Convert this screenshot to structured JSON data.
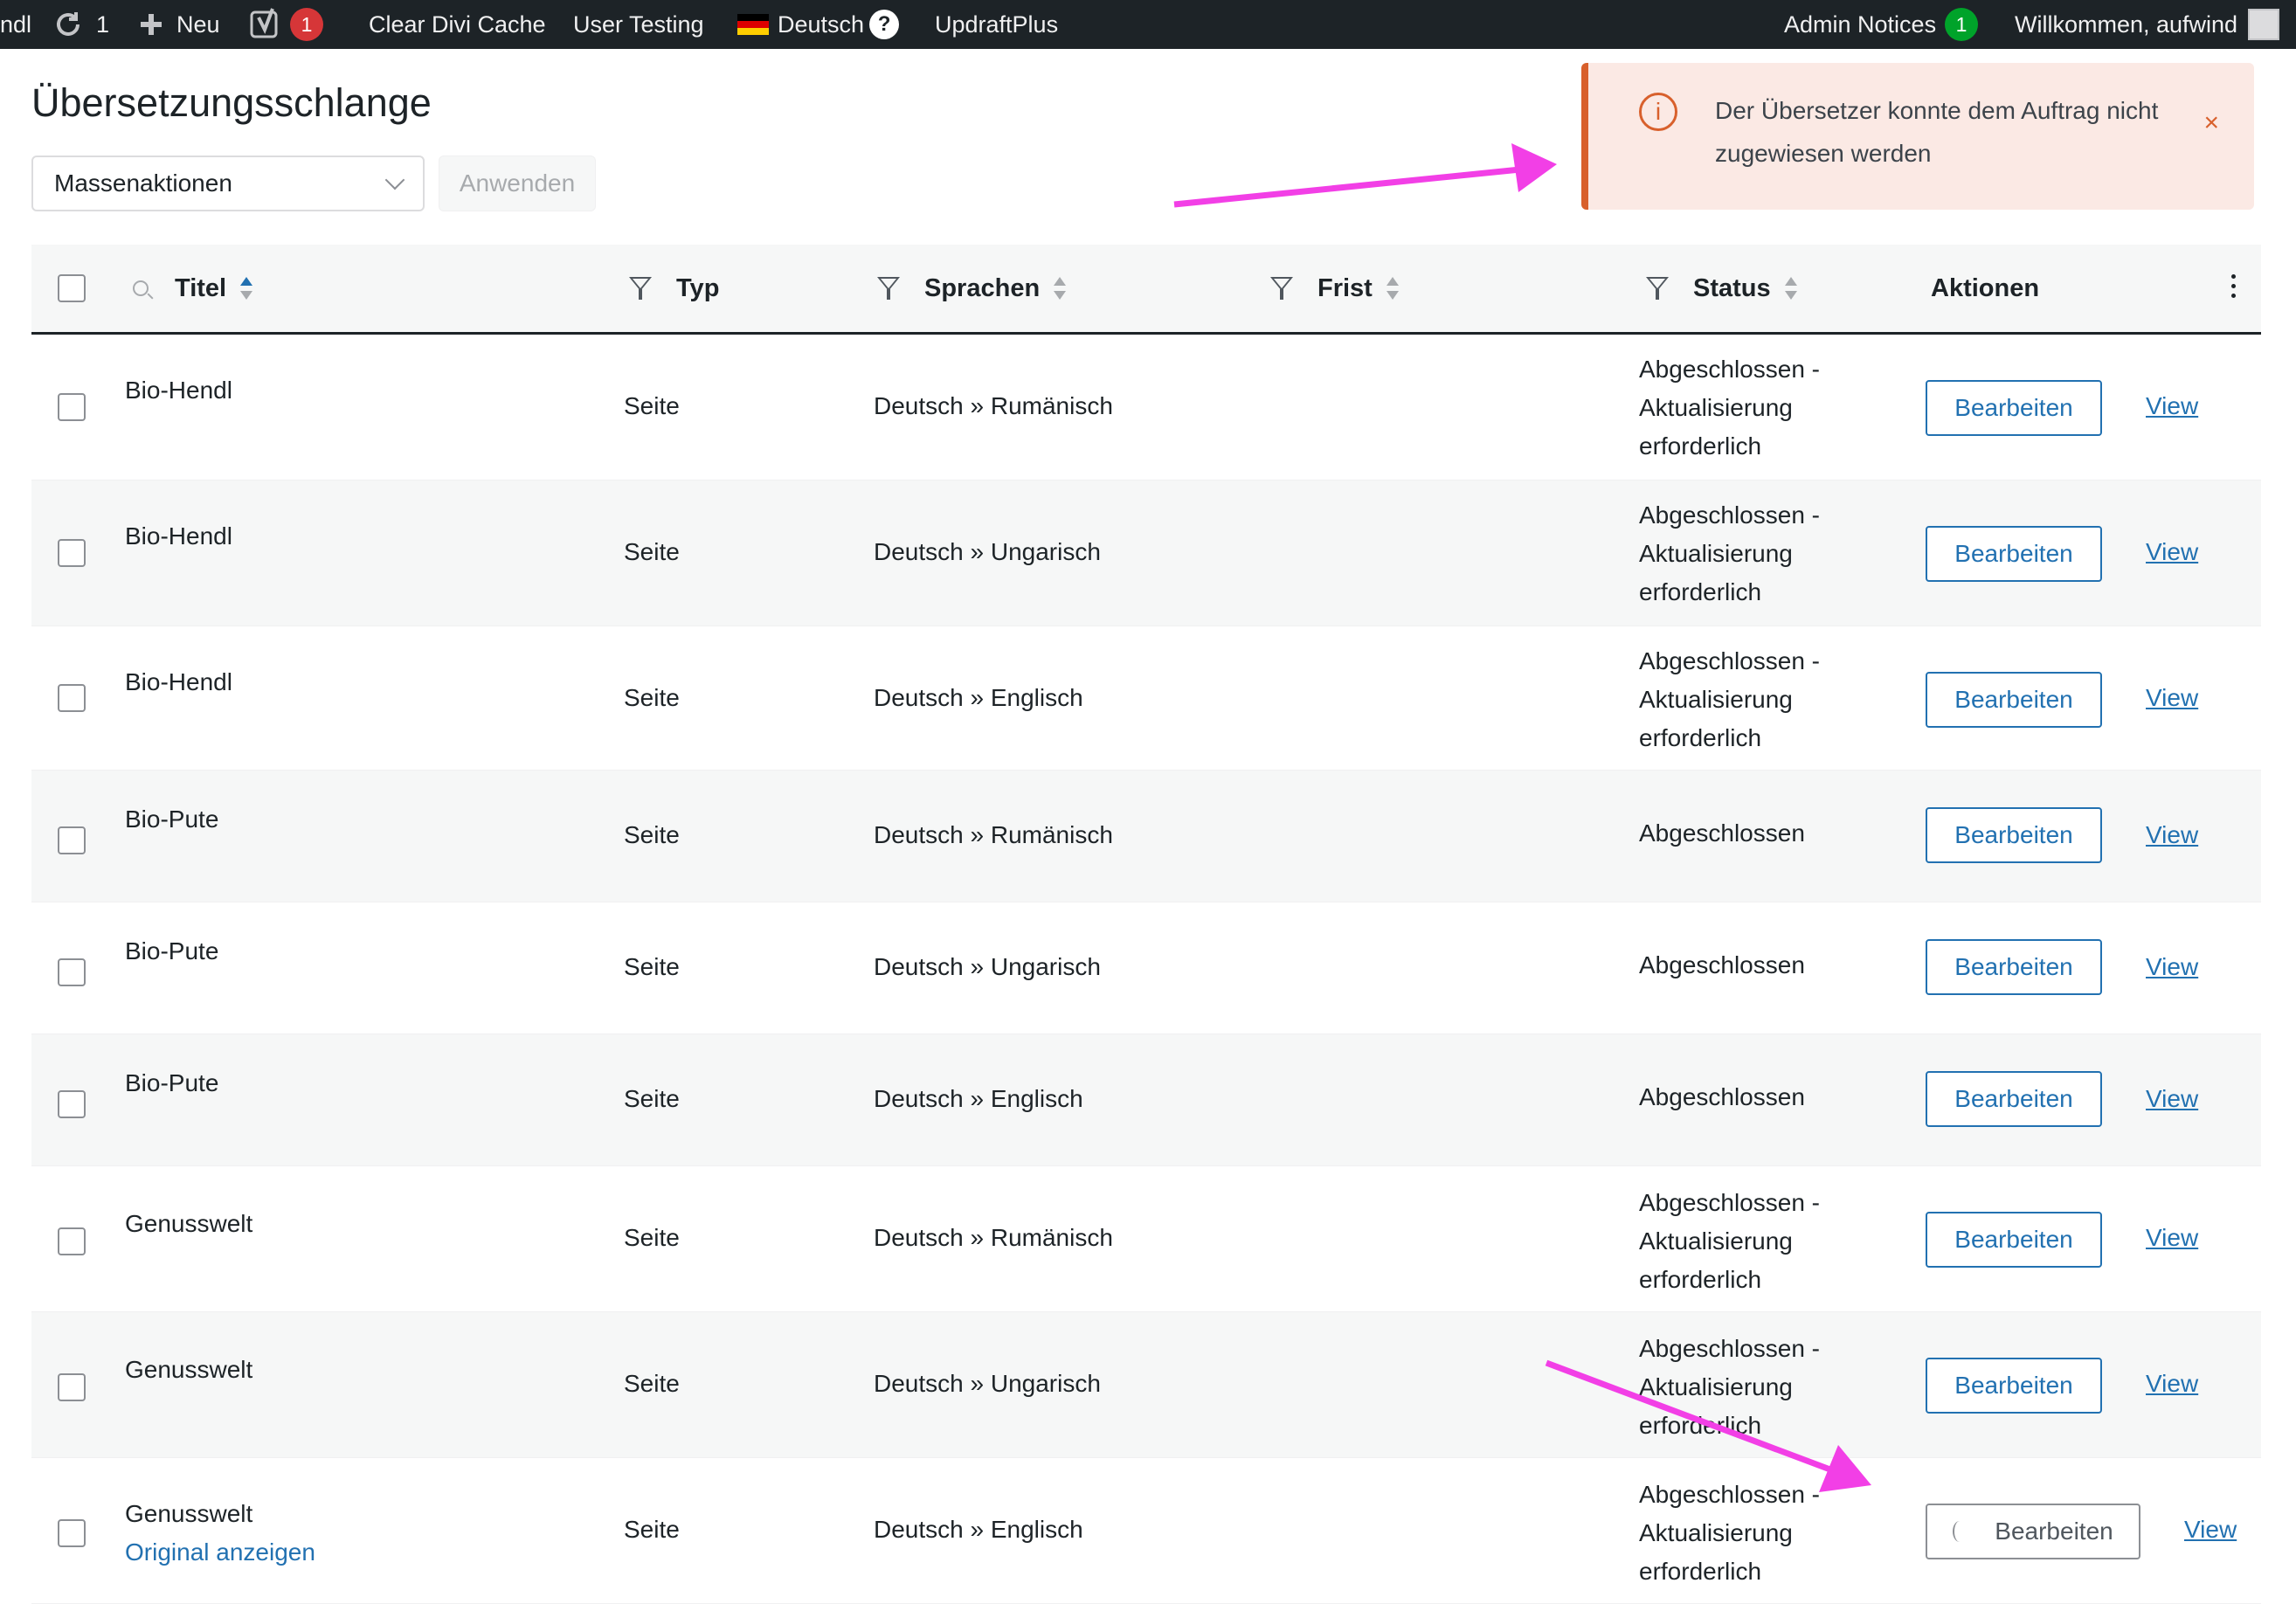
{
  "adminbar": {
    "site_fragment": "ndl",
    "updates_count": "1",
    "new_label": "Neu",
    "yoast_count": "1",
    "clear_cache_label": "Clear Divi Cache",
    "user_testing_label": "User Testing",
    "language_label": "Deutsch",
    "help_label": "?",
    "updraft_label": "UpdraftPlus",
    "admin_notices_label": "Admin Notices",
    "admin_notices_count": "1",
    "welcome_label": "Willkommen, aufwind"
  },
  "page": {
    "title": "Übersetzungsschlange"
  },
  "bulk": {
    "select_label": "Massenaktionen",
    "apply_label": "Anwenden"
  },
  "notice": {
    "icon": "i",
    "message": "Der Übersetzer konnte dem Auftrag nicht zugewiesen werden",
    "close": "×"
  },
  "columns": {
    "title": "Titel",
    "type": "Typ",
    "languages": "Sprachen",
    "deadline": "Frist",
    "status": "Status",
    "actions": "Aktionen"
  },
  "rows": [
    {
      "title": "Bio-Hendl",
      "type": "Seite",
      "languages": "Deutsch » Rumänisch",
      "status": "Abgeschlossen - Aktualisierung erforderlich",
      "edit": "Bearbeiten",
      "view": "View"
    },
    {
      "title": "Bio-Hendl",
      "type": "Seite",
      "languages": "Deutsch » Ungarisch",
      "status": "Abgeschlossen - Aktualisierung erforderlich",
      "edit": "Bearbeiten",
      "view": "View"
    },
    {
      "title": "Bio-Hendl",
      "type": "Seite",
      "languages": "Deutsch » Englisch",
      "status": "Abgeschlossen - Aktualisierung erforderlich",
      "edit": "Bearbeiten",
      "view": "View"
    },
    {
      "title": "Bio-Pute",
      "type": "Seite",
      "languages": "Deutsch » Rumänisch",
      "status": "Abgeschlossen",
      "edit": "Bearbeiten",
      "view": "View"
    },
    {
      "title": "Bio-Pute",
      "type": "Seite",
      "languages": "Deutsch » Ungarisch",
      "status": "Abgeschlossen",
      "edit": "Bearbeiten",
      "view": "View"
    },
    {
      "title": "Bio-Pute",
      "type": "Seite",
      "languages": "Deutsch » Englisch",
      "status": "Abgeschlossen",
      "edit": "Bearbeiten",
      "view": "View"
    },
    {
      "title": "Genusswelt",
      "type": "Seite",
      "languages": "Deutsch » Rumänisch",
      "status": "Abgeschlossen - Aktualisierung erforderlich",
      "edit": "Bearbeiten",
      "view": "View"
    },
    {
      "title": "Genusswelt",
      "type": "Seite",
      "languages": "Deutsch » Ungarisch",
      "status": "Abgeschlossen - Aktualisierung erforderlich",
      "edit": "Bearbeiten",
      "view": "View"
    },
    {
      "title": "Genusswelt",
      "type": "Seite",
      "languages": "Deutsch » Englisch",
      "status": "Abgeschlossen - Aktualisierung erforderlich",
      "edit": "Bearbeiten",
      "view": "View",
      "original_link": "Original anzeigen"
    }
  ],
  "colors": {
    "adminbar_bg": "#1d2327",
    "accent": "#2271b1",
    "notice_border": "#d8602c",
    "notice_bg": "#fbe9e4",
    "annotation_arrow": "#f23fe6"
  }
}
